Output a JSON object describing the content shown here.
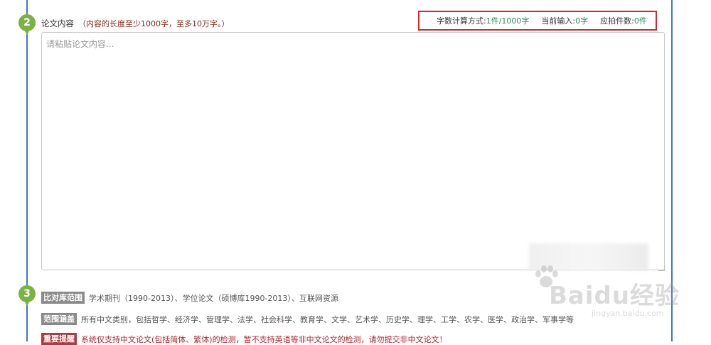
{
  "steps": {
    "content_number": "2",
    "scope_number": "3"
  },
  "section": {
    "title": "论文内容",
    "hint": "（内容的长度至少1000字，至多10万字。）"
  },
  "counter": {
    "method_label": "字数计算方式:",
    "method_value": "1件/1000字",
    "input_label": "当前输入:",
    "input_value": "0字",
    "pieces_label": "应拍件数:",
    "pieces_value": "0件"
  },
  "editor": {
    "placeholder": "请粘贴论文内容..."
  },
  "info": {
    "compare_tag": "比对库范围",
    "compare_text": "学术期刊（1990-2013）、学位论文（硕博库1990-2013）、互联网资源",
    "coverage_tag": "范围涵盖",
    "coverage_text": "所有中文类别，包括哲学、经济学、管理学、法学、社会科学、教育学、文学、艺术学、历史学、理学、工学、农学、医学、政治学、军事学等",
    "notice_tag": "重要提醒",
    "notice_text": "系统仅支持中文论文(包括简体、繁体)的检测，暂不支持英语等非中文论文的检测，请勿提交非中文论文！"
  },
  "watermark": {
    "text": "Baidu经验",
    "sub": "jingyan.baidu.com"
  },
  "colors": {
    "frame": "#3d78c9",
    "step": "#7ab344",
    "highlight": "#d6262c"
  }
}
